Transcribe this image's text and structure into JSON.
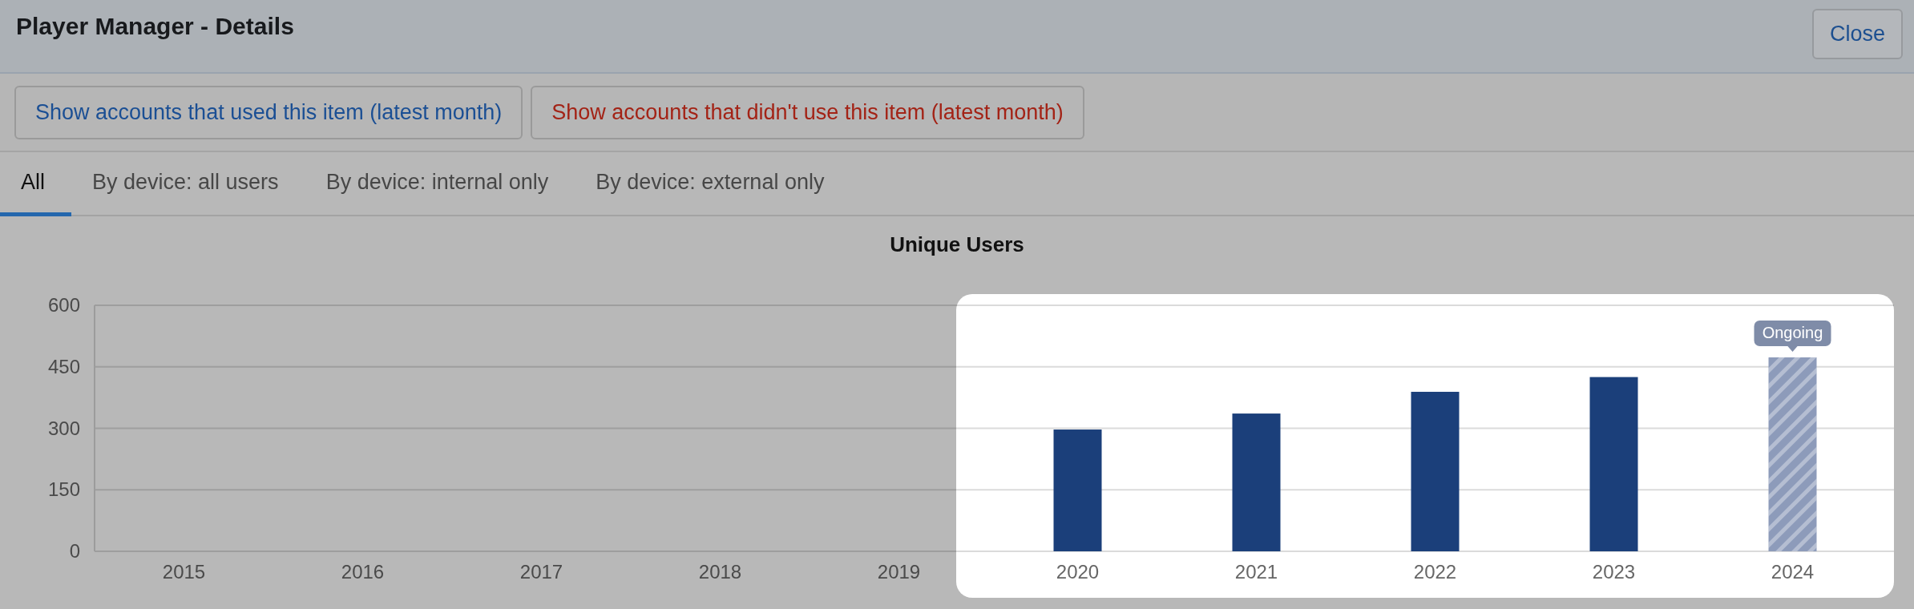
{
  "window": {
    "title": "Player Manager - Details",
    "close_button": "Close"
  },
  "actions": [
    {
      "label": "Show accounts that used this item (latest month)",
      "kind": "positive"
    },
    {
      "label": "Show accounts that didn't use this item (latest month)",
      "kind": "negative"
    }
  ],
  "tabs": [
    {
      "label": "All",
      "selected": true
    },
    {
      "label": "By device: all users",
      "selected": false
    },
    {
      "label": "By device: internal only",
      "selected": false
    },
    {
      "label": "By device: external only",
      "selected": false
    }
  ],
  "chart": {
    "chart_data": {
      "type": "bar",
      "title": "Unique Users",
      "categories": [
        "2015",
        "2016",
        "2017",
        "2018",
        "2019",
        "2020",
        "2021",
        "2022",
        "2023",
        "2024"
      ],
      "series": [
        {
          "color": "#1b3f7a",
          "values": [
            null,
            null,
            null,
            null,
            null,
            297,
            336,
            389,
            425,
            null
          ]
        },
        {
          "name": "Ongoing",
          "color": "#8d9bba",
          "values": [
            null,
            null,
            null,
            null,
            null,
            null,
            null,
            null,
            null,
            473
          ]
        }
      ],
      "grid": true,
      "ylim": [
        0,
        600
      ],
      "yticks": [
        0,
        150,
        300,
        450,
        600
      ]
    }
  }
}
